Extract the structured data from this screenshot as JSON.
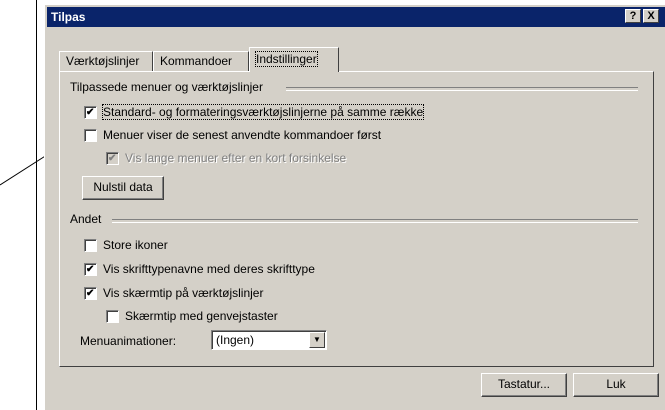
{
  "dialog": {
    "title": "Tilpas",
    "help_icon_text": "?",
    "close_icon_text": "X"
  },
  "tabs": [
    {
      "label": "Værktøjslinjer",
      "active": false
    },
    {
      "label": "Kommandoer",
      "active": false
    },
    {
      "label": "Indstillinger",
      "active": true
    }
  ],
  "group_menus": {
    "label": "Tilpassede menuer og værktøjslinjer",
    "options": [
      {
        "label": "Standard- og formateringsværktøjslinjerne på samme række",
        "checked": true,
        "enabled": true
      },
      {
        "label": "Menuer viser de senest anvendte kommandoer først",
        "checked": false,
        "enabled": true
      },
      {
        "label": "Vis lange menuer efter en kort forsinkelse",
        "checked": true,
        "enabled": false
      }
    ],
    "reset_button": "Nulstil data"
  },
  "group_other": {
    "label": "Andet",
    "options": [
      {
        "label": "Store ikoner",
        "checked": false
      },
      {
        "label": "Vis skrifttypenavne med deres skrifttype",
        "checked": true
      },
      {
        "label": "Vis skærmtip på værktøjslinjer",
        "checked": true
      },
      {
        "label": "Skærmtip med genvejstaster",
        "checked": false
      }
    ],
    "animation_label": "Menuanimationer:",
    "animation_value": "(Ingen)"
  },
  "footer": {
    "keyboard_button": "Tastatur...",
    "close_button": "Luk"
  }
}
